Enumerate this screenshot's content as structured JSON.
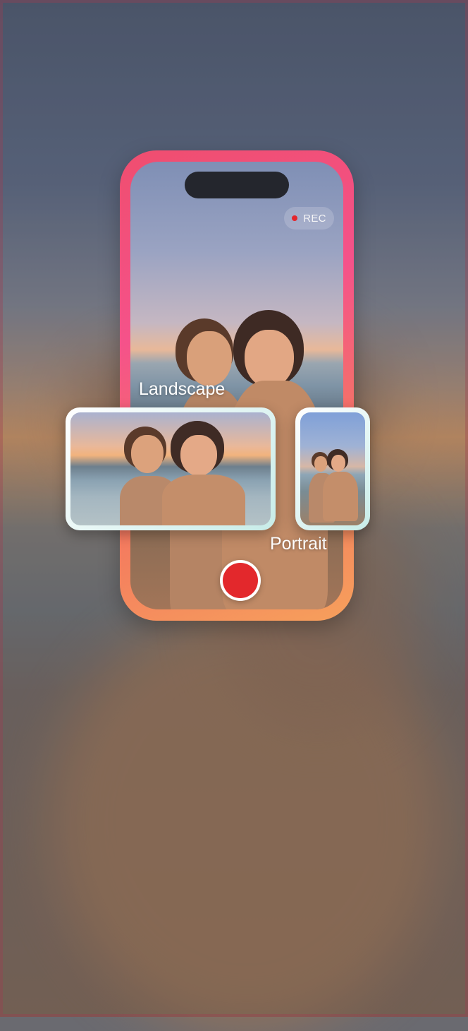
{
  "status": {
    "rec_label": "REC",
    "rec_color": "#e4262c"
  },
  "modes": {
    "landscape_label": "Landscape",
    "portrait_label": "Portrait"
  },
  "controls": {
    "shutter_color": "#e3282c"
  },
  "colors": {
    "phone_gradient_start": "#ef4e6f",
    "phone_gradient_end": "#f6a05c",
    "card_border": "#dff4f2"
  }
}
